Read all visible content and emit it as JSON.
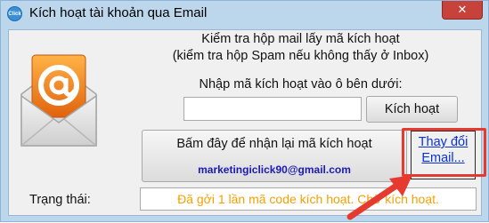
{
  "window": {
    "title": "Kích hoạt tài khoản qua Email",
    "app_icon_text": "Click",
    "close_symbol": "✕"
  },
  "instructions": {
    "line1": "Kiểm tra hộp mail lấy mã kích hoạt",
    "line2": "(kiểm tra hộp Spam nếu không thấy ở Inbox)"
  },
  "activation": {
    "prompt": "Nhập mã kích hoạt vào ô bên dưới:",
    "code_value": "",
    "activate_label": "Kích hoạt"
  },
  "resend": {
    "label": "Bấm đây để nhận lại mã kích hoạt",
    "email": "marketingiclick90@gmail.com"
  },
  "change_email": {
    "line1": "Thay đổi",
    "line2": "Email..."
  },
  "status": {
    "label": "Trạng thái:",
    "value": "Đã gởi 1 lần mã code kích hoạt. Chờ kích hoạt."
  },
  "colors": {
    "status_text": "#f5a000",
    "link": "#0b30d6",
    "email_text": "#1a1ab4",
    "annotation": "#e6392f",
    "close_button": "#c7423a"
  },
  "icons": [
    "app-icon",
    "close-icon",
    "email-envelope-icon",
    "annotation-arrow"
  ]
}
